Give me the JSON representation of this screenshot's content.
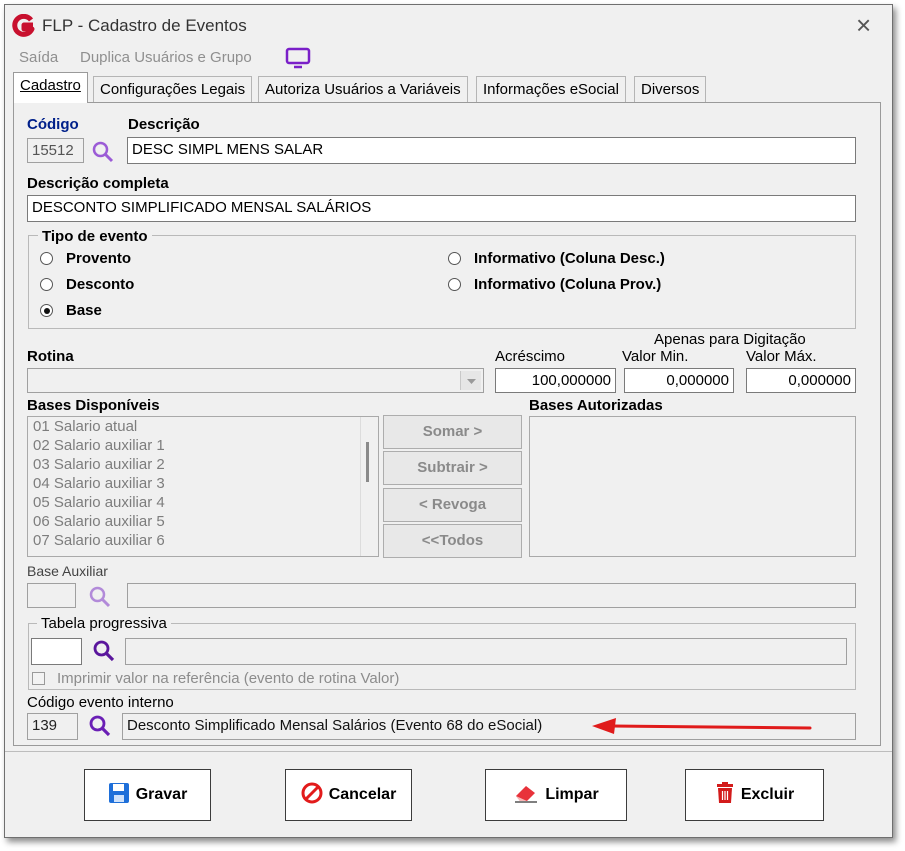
{
  "window": {
    "title": "FLP - Cadastro de Eventos",
    "close": "×"
  },
  "menu": {
    "saida": "Saída",
    "duplica": "Duplica Usuários e Grupo"
  },
  "tabs": [
    {
      "label": "Cadastro"
    },
    {
      "label": "Configurações Legais"
    },
    {
      "label": "Autoriza Usuários a Variáveis"
    },
    {
      "label": "Informações eSocial"
    },
    {
      "label": "Diversos"
    }
  ],
  "form": {
    "codigo_label": "Código",
    "codigo_value": "15512",
    "descricao_label": "Descrição",
    "descricao_value": "DESC SIMPL MENS SALAR",
    "descricao_completa_label": "Descrição completa",
    "descricao_completa_value": "DESCONTO SIMPLIFICADO MENSAL SALÁRIOS",
    "tipo_evento": {
      "label": "Tipo de evento",
      "options": [
        "Provento",
        "Desconto",
        "Base",
        "Informativo (Coluna Desc.)",
        "Informativo (Coluna Prov.)"
      ],
      "selected": "Base"
    },
    "rotina_label": "Rotina",
    "rotina_value": "",
    "acrescimo_label": "Acréscimo",
    "acrescimo_value": "100,000000",
    "apenas_label": "Apenas para Digitação",
    "valor_min_label": "Valor Min.",
    "valor_min_value": "0,000000",
    "valor_max_label": "Valor Máx.",
    "valor_max_value": "0,000000",
    "bases_disponiveis_label": "Bases Disponíveis",
    "bases_disponiveis": [
      "01 Salario atual",
      "02 Salario auxiliar 1",
      "03 Salario auxiliar 2",
      "04 Salario auxiliar 3",
      "05 Salario auxiliar 4",
      "06 Salario auxiliar 5",
      "07 Salario auxiliar 6"
    ],
    "bases_autorizadas_label": "Bases Autorizadas",
    "buttons_side": [
      "Somar >",
      "Subtrair >",
      "< Revoga",
      "<<Todos"
    ],
    "base_auxiliar_label": "Base Auxiliar",
    "tabela_progressiva_label": "Tabela progressiva",
    "imprimir_label": "Imprimir valor na referência (evento de rotina Valor)",
    "codigo_interno_label": "Código evento interno",
    "codigo_interno_value": "139",
    "codigo_interno_desc": "Desconto Simplificado Mensal Salários (Evento 68 do eSocial)"
  },
  "buttons": {
    "gravar": "Gravar",
    "cancelar": "Cancelar",
    "limpar": "Limpar",
    "excluir": "Excluir"
  },
  "colors": {
    "accent": "#6a1fb5",
    "logo": "#c8102e",
    "arrow": "#e01b1b",
    "codigo_label": "#00208a"
  }
}
